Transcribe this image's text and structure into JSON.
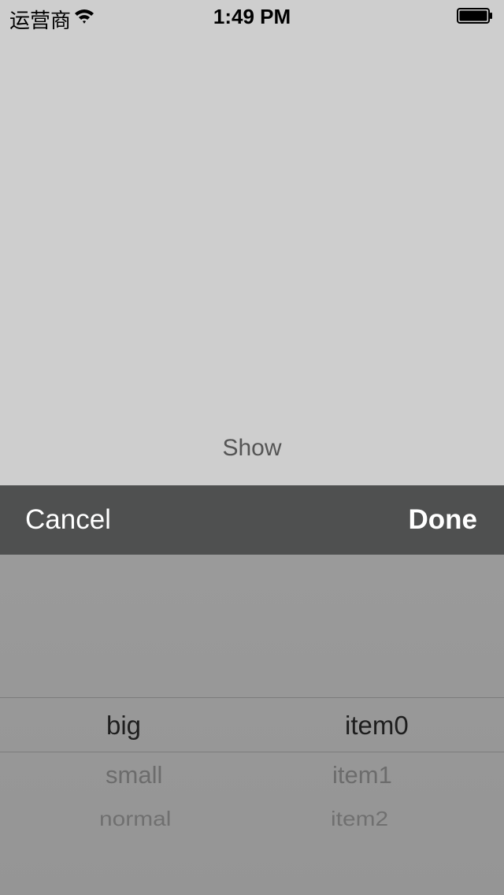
{
  "status_bar": {
    "carrier": "运营商",
    "time": "1:49 PM",
    "wifi_icon": "wifi-icon",
    "battery_icon": "battery-icon"
  },
  "main": {
    "show_label": "Show"
  },
  "picker_sheet": {
    "toolbar": {
      "cancel_label": "Cancel",
      "done_label": "Done"
    },
    "columns": [
      {
        "rows": [
          "big",
          "small",
          "normal"
        ],
        "selected": "big"
      },
      {
        "rows": [
          "item0",
          "item1",
          "item2"
        ],
        "selected": "item0"
      }
    ]
  }
}
